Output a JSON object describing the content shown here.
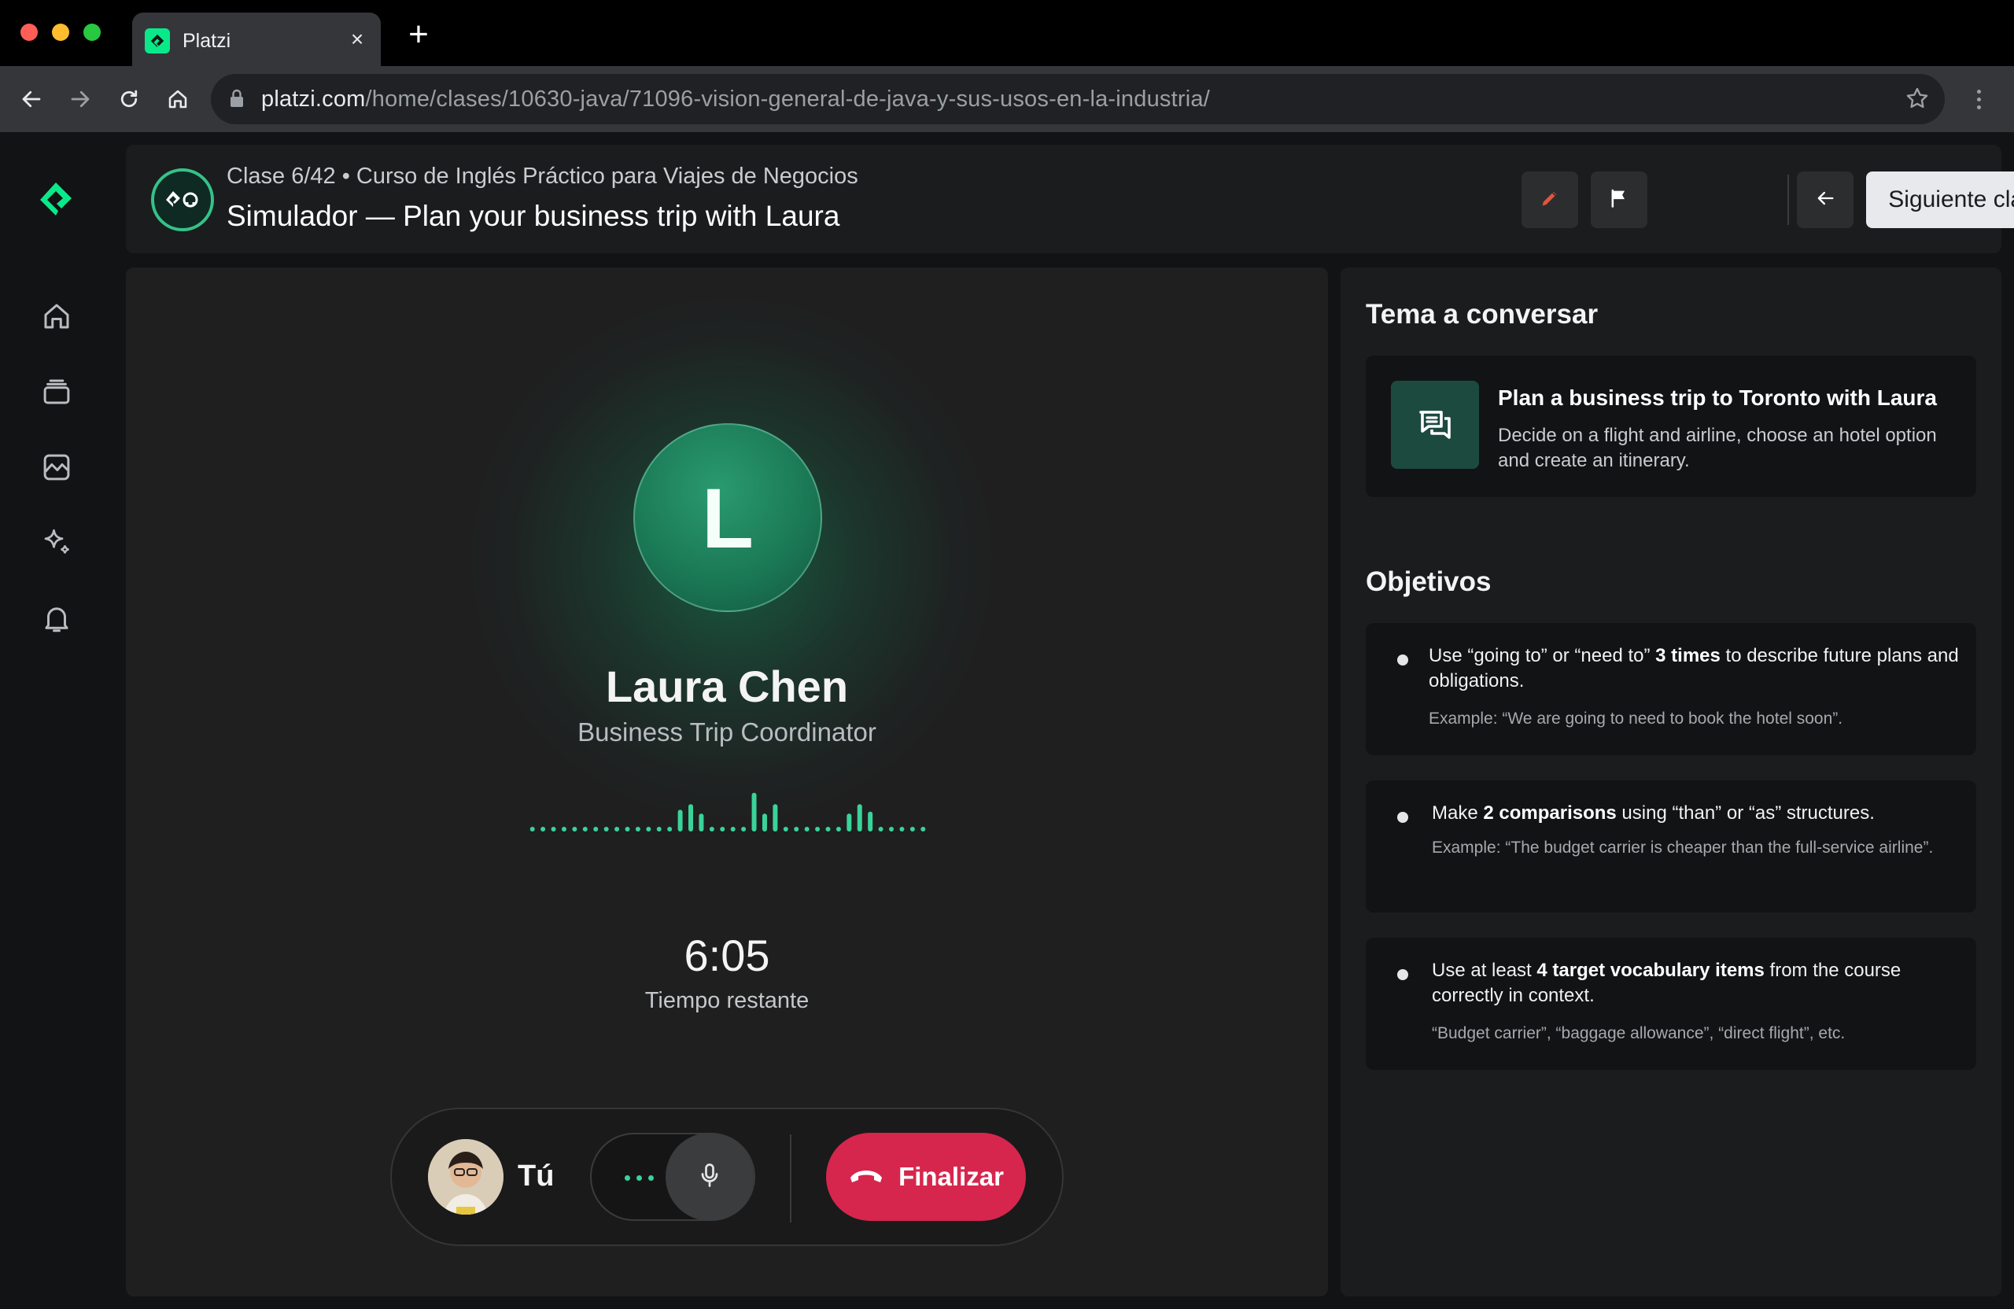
{
  "browser": {
    "tab_title": "Platzi",
    "url_host": "platzi.com",
    "url_path": "/home/clases/10630-java/71096-vision-general-de-java-y-sus-usos-en-la-industria/"
  },
  "sidebar": {
    "items": [
      {
        "icon": "home-icon"
      },
      {
        "icon": "courses-stack-icon"
      },
      {
        "icon": "analytics-icon"
      },
      {
        "icon": "sparkles-icon"
      },
      {
        "icon": "bell-icon"
      }
    ]
  },
  "header": {
    "class_meta": "Clase 6/42 • Curso de Inglés Práctico para Viajes de Negocios",
    "class_title": "Simulador — Plan your business trip with Laura",
    "next_label": "Siguiente clase"
  },
  "call": {
    "avatar_letter": "L",
    "name": "Laura Chen",
    "role": "Business Trip Coordinator",
    "timer": "6:05",
    "timer_label": "Tiempo restante",
    "me_label": "Tú",
    "end_label": "Finalizar",
    "waveform_levels": [
      0,
      0,
      0,
      0,
      0,
      0,
      0,
      0,
      0,
      0,
      0,
      0,
      0,
      0,
      0.45,
      0.6,
      0.35,
      0,
      0,
      0,
      0,
      0.9,
      0.35,
      0.6,
      0,
      0,
      0,
      0,
      0,
      0,
      0.35,
      0.6,
      0.4,
      0,
      0,
      0,
      0,
      0
    ],
    "accent_color": "#3ad39a",
    "end_color": "#d6264e"
  },
  "topic": {
    "section_title": "Tema a conversar",
    "title": "Plan a business trip to Toronto with Laura",
    "description": "Decide on a flight and airline, choose an hotel option and create an itinerary."
  },
  "objectives": {
    "section_title": "Objetivos",
    "items": [
      {
        "pre": "Use “going to” or “need to” ",
        "bold": "3 times",
        "post": " to describe future plans and obligations.",
        "example": "Example: “We are going to need to book the hotel soon”."
      },
      {
        "pre": "Make ",
        "bold": "2 comparisons",
        "post": " using “than” or “as” structures.",
        "example": "Example: “The budget carrier is cheaper than the full-service airline”."
      },
      {
        "pre": "Use at least ",
        "bold": "4 target vocabulary items",
        "post": " from the course correctly in context.",
        "example": "“Budget carrier”, “baggage allowance”, “direct flight”, etc."
      }
    ]
  }
}
